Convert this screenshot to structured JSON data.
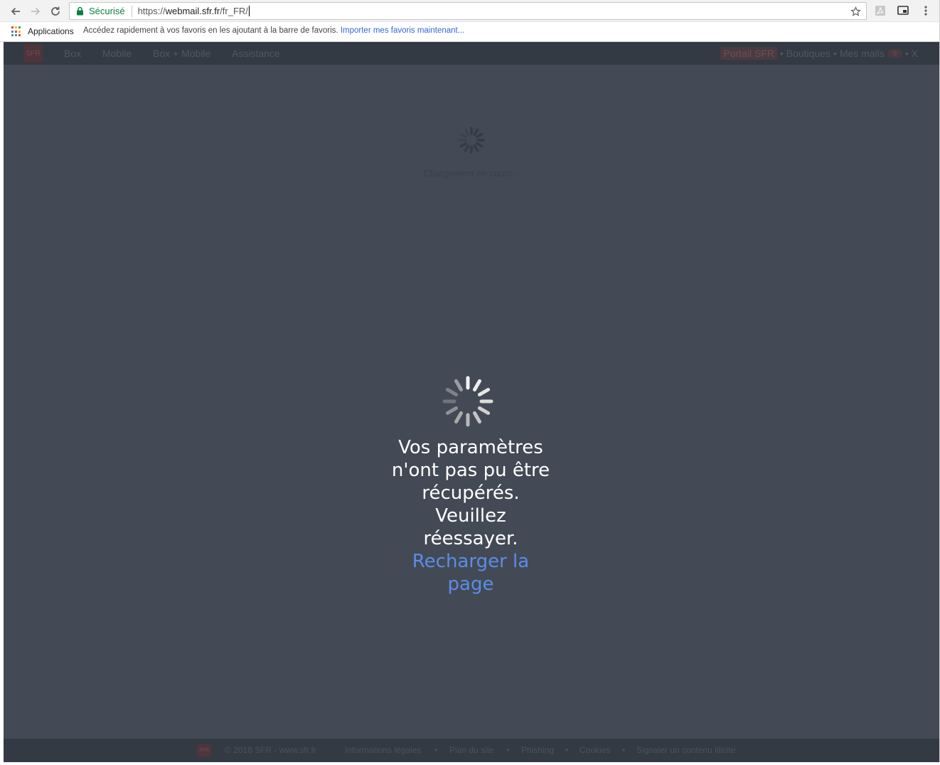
{
  "browser": {
    "security_label": "Sécurisé",
    "url_scheme": "https://",
    "url_host": "webmail.sfr.fr",
    "url_path": "/fr_FR/"
  },
  "bookmarks": {
    "apps_label": "Applications",
    "hint": "Accédez rapidement à vos favoris en les ajoutant à la barre de favoris.",
    "import_link": "Importer mes favoris maintenant..."
  },
  "topnav": {
    "logo": "SFR",
    "items": [
      "Box",
      "Mobile",
      "Box + Mobile",
      "Assistance"
    ],
    "portail": "Portail SFR",
    "boutiques": "• Boutiques •",
    "mes_mails": "Mes mails",
    "mail_count": "0",
    "close": "• X"
  },
  "loading": {
    "background_text": "Chargement en cours..."
  },
  "error": {
    "message": "Vos paramètres n'ont pas pu être récupérés. Veuillez réessayer.",
    "reload_label": "Recharger la page"
  },
  "footer": {
    "logo": "SFR",
    "copyright": "© 2018 SFR - www.sfr.fr",
    "links": [
      "Informations légales",
      "Plan du site",
      "Phishing",
      "Cookies",
      "Signaler un contenu illicite"
    ],
    "separator": "•"
  },
  "colors": {
    "page_bg": "#434a55",
    "nav_bg": "#333a44",
    "link": "#5b8de6",
    "secure_green": "#0b8043"
  }
}
